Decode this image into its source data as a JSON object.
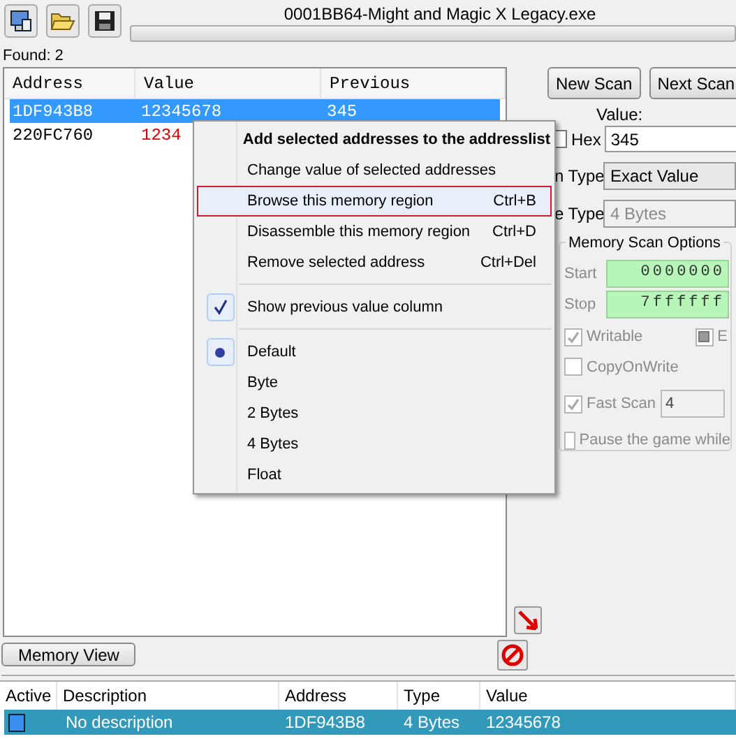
{
  "window": {
    "title": "0001BB64-Might and Magic X Legacy.exe"
  },
  "progress": {
    "level": 0
  },
  "found": "Found: 2",
  "results": {
    "columns": [
      "Address",
      "Value",
      "Previous"
    ],
    "rows": [
      {
        "address": "1DF943B8",
        "value": "12345678",
        "previous": "345",
        "selected": true,
        "changed": false
      },
      {
        "address": "220FC760",
        "value": "1234",
        "selected": false,
        "changed": true
      }
    ]
  },
  "scan_buttons": [
    "New Scan",
    "Next Scan"
  ],
  "value": {
    "label": "Value:",
    "hex": {
      "label": "Hex",
      "checked": false
    },
    "value": "345"
  },
  "scan_type": {
    "label": "n Type",
    "value": "Exact Value",
    "disabled": false
  },
  "value_type": {
    "label": "e Type",
    "value": "4 Bytes",
    "disabled": true
  },
  "scan_options": {
    "title": "Memory Scan Options",
    "start": {
      "label": "Start",
      "value": "0000000"
    },
    "stop": {
      "label": "Stop",
      "value": "7ffffff"
    },
    "writable": {
      "label": "Writable",
      "checked": true,
      "disabled": true
    },
    "executable": {
      "label": "E",
      "checked": false,
      "indeterminate": true,
      "disabled": true
    },
    "copy_on_write": {
      "label": "CopyOnWrite",
      "checked": false,
      "disabled": true
    },
    "fast_scan": {
      "label": "Fast Scan",
      "checked": true,
      "disabled": true,
      "value": "4"
    },
    "pause": {
      "label": "Pause the game while",
      "checked": false,
      "disabled": true
    }
  },
  "context_menu": [
    {
      "kind": "bold",
      "label": "Add selected addresses to the addresslist",
      "selected": false
    },
    {
      "kind": "item",
      "label": "Change value of selected addresses",
      "selected": false
    },
    {
      "kind": "item",
      "label": "Browse this memory region",
      "shortcut": "Ctrl+B",
      "selected": true
    },
    {
      "kind": "item",
      "label": "Disassemble this memory region",
      "shortcut": "Ctrl+D",
      "selected": false
    },
    {
      "kind": "item",
      "label": "Remove selected address",
      "shortcut": "Ctrl+Del",
      "selected": false
    },
    {
      "kind": "separator"
    },
    {
      "kind": "check",
      "label": "Show previous value column",
      "checked": true,
      "selected": false
    },
    {
      "kind": "separator"
    },
    {
      "kind": "radio",
      "label": "Default",
      "checked": true,
      "selected": false
    },
    {
      "kind": "radio",
      "label": "Byte",
      "checked": false,
      "selected": false
    },
    {
      "kind": "radio",
      "label": "2 Bytes",
      "checked": false,
      "selected": false
    },
    {
      "kind": "radio",
      "label": "4 Bytes",
      "checked": false,
      "selected": false
    },
    {
      "kind": "radio",
      "label": "Float",
      "checked": false,
      "selected": false
    }
  ],
  "memory_view_button": "Memory View",
  "address_list": {
    "columns": [
      "Active",
      "Description",
      "Address",
      "Type",
      "Value"
    ],
    "rows": [
      {
        "active": false,
        "description": "No description",
        "address": "1DF943B8",
        "type": "4 Bytes",
        "value": "12345678",
        "selected": true
      }
    ]
  }
}
